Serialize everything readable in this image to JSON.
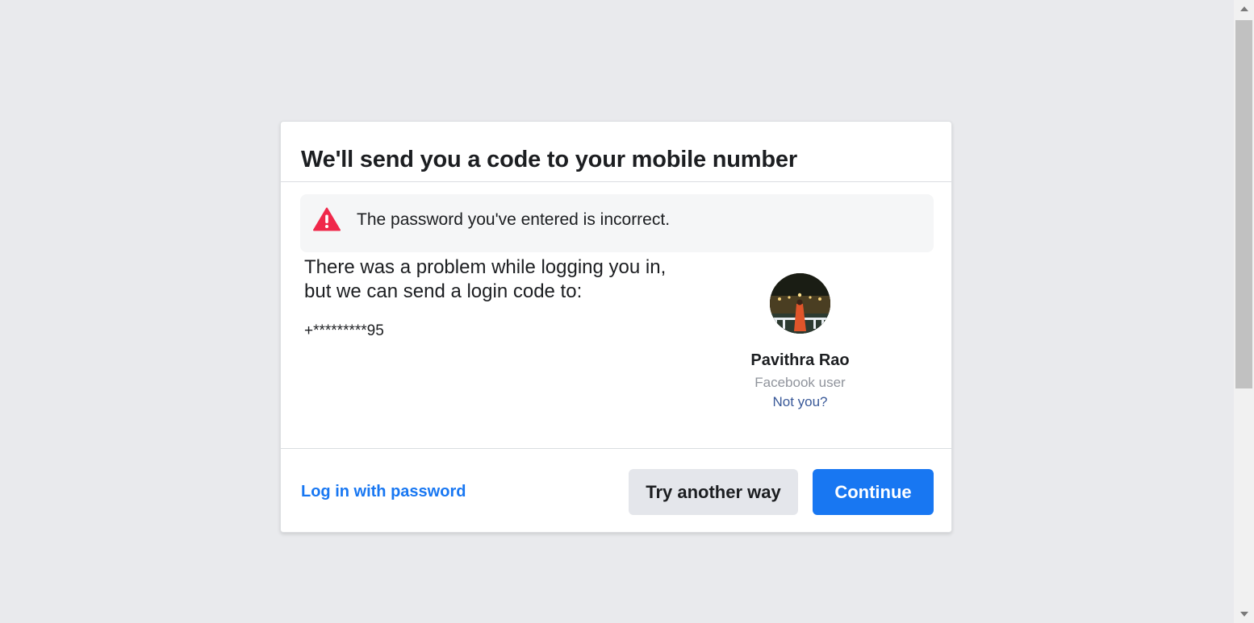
{
  "dialog": {
    "title": "We'll send you a code to your mobile number",
    "error": {
      "icon": "warning-icon",
      "icon_color": "#f0284a",
      "message": "The password you've entered is incorrect."
    },
    "body_text": "There was a problem while logging you in, but we can send a login code to:",
    "phone_number": "+*********95"
  },
  "profile": {
    "avatar": "profile-photo",
    "name": "Pavithra Rao",
    "subtitle": "Facebook user",
    "not_you_link": "Not you?"
  },
  "footer": {
    "login_password_link": "Log in with password",
    "try_another_button": "Try another way",
    "continue_button": "Continue"
  },
  "colors": {
    "primary": "#1877f2",
    "background": "#e9eaed",
    "link": "#385898"
  }
}
